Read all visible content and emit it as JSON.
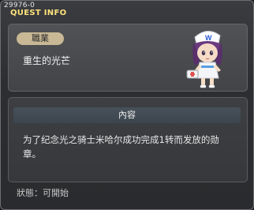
{
  "window": {
    "quest_id": "29976-0",
    "title": "QUEST INFO"
  },
  "quest": {
    "job_label": "職業",
    "name": "重生的光芒",
    "content_header": "內容",
    "content_text": "为了纪念光之骑士米哈尔成功完成1转而发放的勋章。",
    "status": "狀態：可開始"
  },
  "npc": {
    "icon": "npc-nurse-icon"
  },
  "colors": {
    "title": "#ffe27a",
    "badge": "#c9b895",
    "content_header_bg": "#47515a"
  }
}
